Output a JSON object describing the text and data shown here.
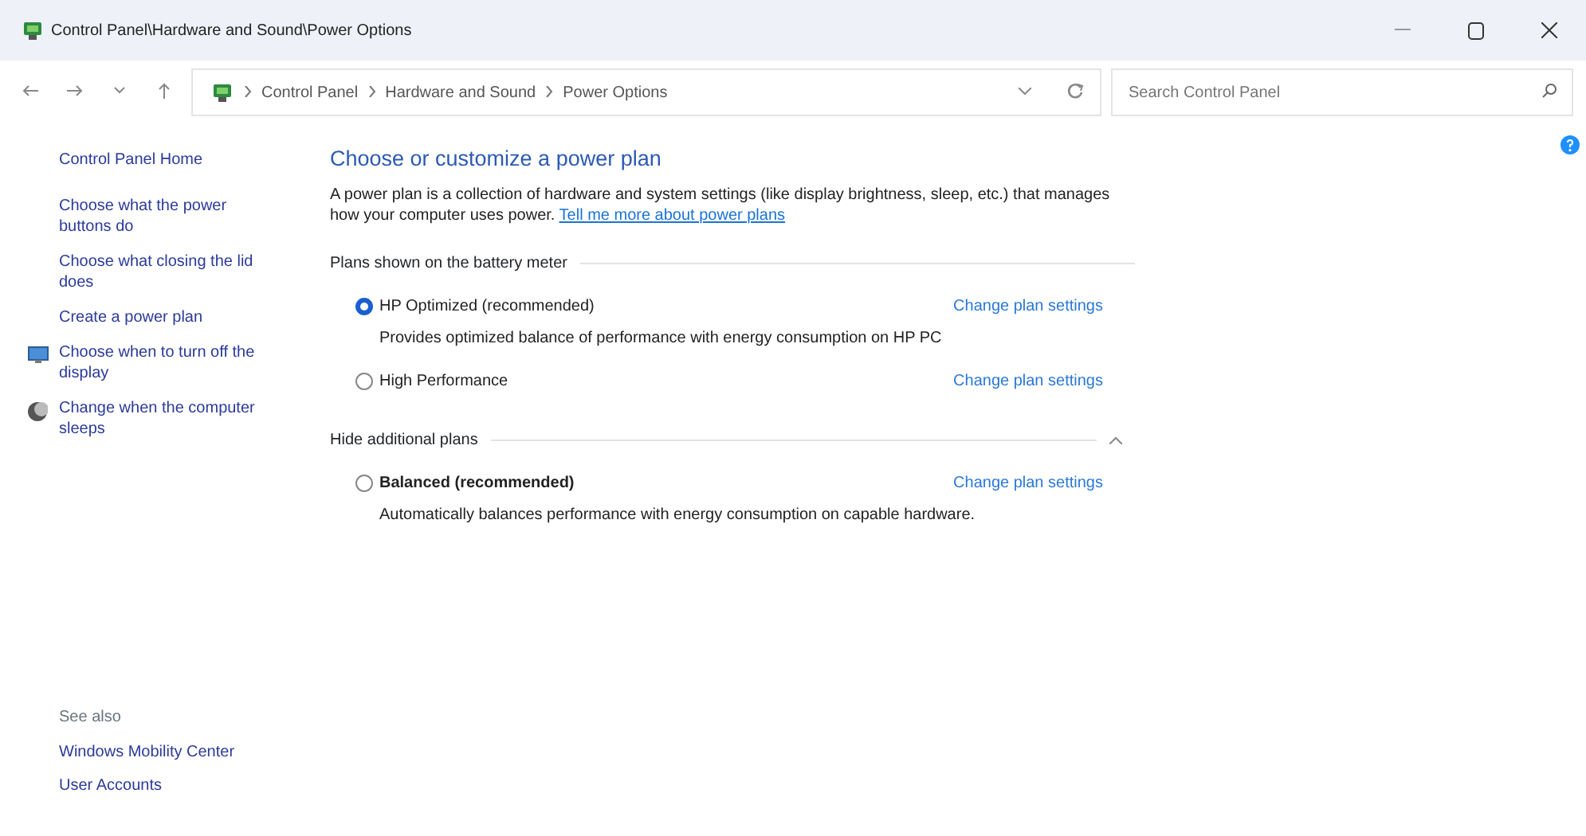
{
  "window": {
    "title": "Control Panel\\Hardware and Sound\\Power Options"
  },
  "address_bar": {
    "breadcrumbs": [
      "Control Panel",
      "Hardware and Sound",
      "Power Options"
    ],
    "search_placeholder": "Search Control Panel"
  },
  "sidebar": {
    "items": [
      {
        "label": "Control Panel Home",
        "kind": "plain"
      },
      {
        "label": "Choose what the power buttons do",
        "kind": "plain"
      },
      {
        "label": "Choose what closing the lid does",
        "kind": "plain"
      },
      {
        "label": "Create a power plan",
        "kind": "plain"
      },
      {
        "label": "Choose when to turn off the display",
        "kind": "display"
      },
      {
        "label": "Change when the computer sleeps",
        "kind": "sleep"
      }
    ],
    "see_also": {
      "title": "See also",
      "links": [
        "Windows Mobility Center",
        "User Accounts"
      ]
    }
  },
  "main": {
    "heading": "Choose or customize a power plan",
    "description": "A power plan is a collection of hardware and system settings (like display brightness, sleep, etc.) that manages how your computer uses power.",
    "description_link": "Tell me more about power plans",
    "groups": [
      {
        "title": "Plans shown on the battery meter",
        "plans": [
          {
            "name": "HP Optimized (recommended)",
            "selected": true,
            "bold": false,
            "description": "Provides optimized balance of performance with energy consumption on HP PC",
            "link": "Change plan settings"
          },
          {
            "name": "High Performance",
            "selected": false,
            "bold": false,
            "link": "Change plan settings"
          }
        ]
      },
      {
        "title": "Hide additional plans",
        "expanded": true,
        "plans": [
          {
            "name": "Balanced (recommended)",
            "selected": false,
            "bold": true,
            "description": "Automatically balances performance with energy consumption on capable hardware.",
            "link": "Change plan settings"
          }
        ]
      }
    ]
  }
}
